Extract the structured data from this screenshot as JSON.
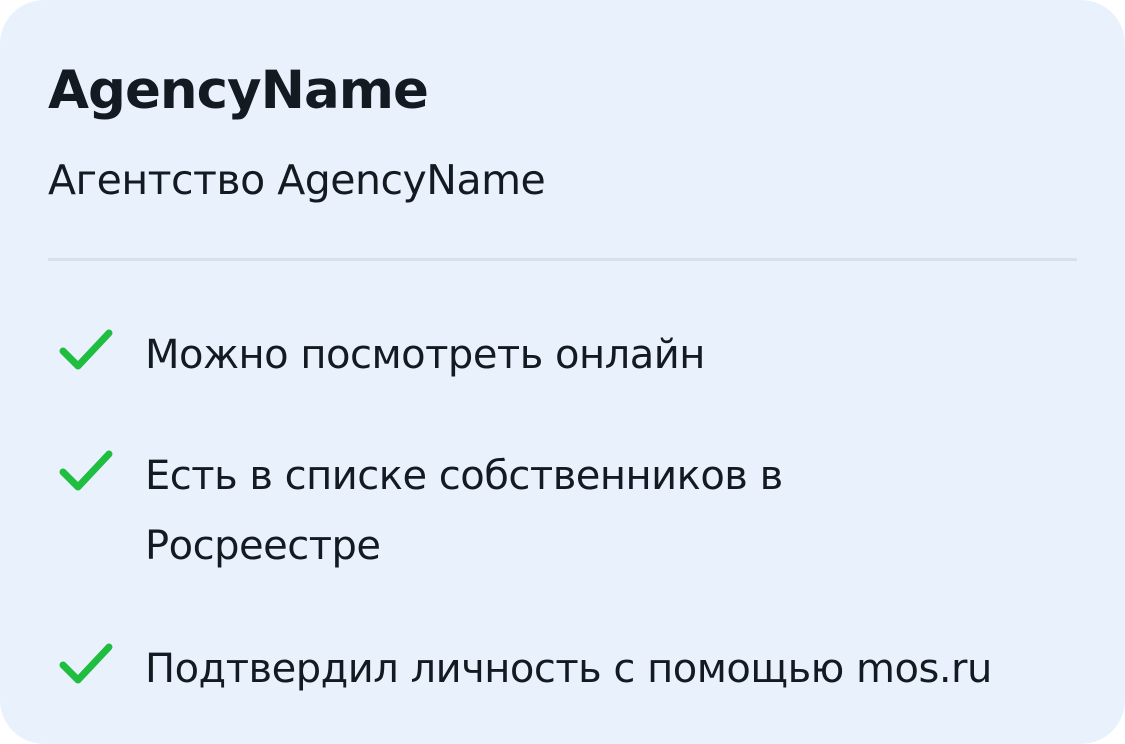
{
  "agency": {
    "name": "AgencyName",
    "subtitle": "Агентство AgencyName"
  },
  "features": [
    {
      "icon": "check-icon",
      "text": "Можно посмотреть онлайн"
    },
    {
      "icon": "check-icon",
      "text": "Есть в списке собственников в Росреестре"
    },
    {
      "icon": "check-icon",
      "text": "Подтвердил личность с помощью mos.ru"
    }
  ],
  "colors": {
    "card_background": "#e9f2fc",
    "check": "#1fbd40",
    "text": "#141a22",
    "divider": "#d7e1ec"
  }
}
